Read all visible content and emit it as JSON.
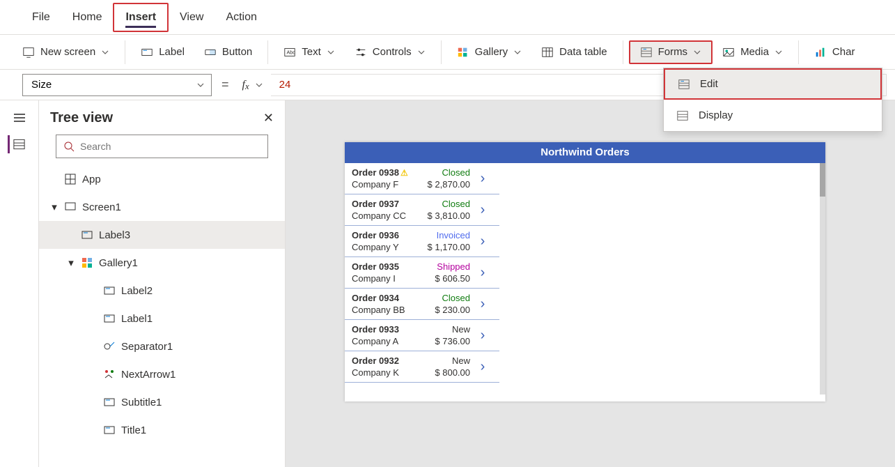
{
  "menubar": [
    "File",
    "Home",
    "Insert",
    "View",
    "Action"
  ],
  "menubar_active": 2,
  "ribbon": {
    "new_screen": "New screen",
    "label_btn": "Label",
    "button": "Button",
    "text": "Text",
    "controls": "Controls",
    "gallery": "Gallery",
    "data_table": "Data table",
    "forms": "Forms",
    "media": "Media",
    "chart": "Char"
  },
  "formula": {
    "property": "Size",
    "value": "24"
  },
  "panel": {
    "title": "Tree view",
    "search_placeholder": "Search",
    "tree": [
      {
        "lvl": 1,
        "icon": "app",
        "label": "App",
        "tw": ""
      },
      {
        "lvl": 1,
        "icon": "screen",
        "label": "Screen1",
        "tw": "▾"
      },
      {
        "lvl": 2,
        "icon": "label",
        "label": "Label3",
        "tw": "",
        "sel": true
      },
      {
        "lvl": 2,
        "icon": "gallery",
        "label": "Gallery1",
        "tw": "▾"
      },
      {
        "lvl": 3,
        "icon": "label",
        "label": "Label2",
        "tw": ""
      },
      {
        "lvl": 3,
        "icon": "label",
        "label": "Label1",
        "tw": ""
      },
      {
        "lvl": 3,
        "icon": "sep",
        "label": "Separator1",
        "tw": ""
      },
      {
        "lvl": 3,
        "icon": "arrow",
        "label": "NextArrow1",
        "tw": ""
      },
      {
        "lvl": 3,
        "icon": "label",
        "label": "Subtitle1",
        "tw": ""
      },
      {
        "lvl": 3,
        "icon": "label",
        "label": "Title1",
        "tw": ""
      }
    ]
  },
  "app": {
    "title": "Northwind Orders",
    "rows": [
      {
        "order": "Order 0938",
        "warn": true,
        "status": "Closed",
        "status_color": "#107c10",
        "company": "Company F",
        "amount": "$ 2,870.00"
      },
      {
        "order": "Order 0937",
        "status": "Closed",
        "status_color": "#107c10",
        "company": "Company CC",
        "amount": "$ 3,810.00"
      },
      {
        "order": "Order 0936",
        "status": "Invoiced",
        "status_color": "#4f6bed",
        "company": "Company Y",
        "amount": "$ 1,170.00"
      },
      {
        "order": "Order 0935",
        "status": "Shipped",
        "status_color": "#b4009e",
        "company": "Company I",
        "amount": "$ 606.50"
      },
      {
        "order": "Order 0934",
        "status": "Closed",
        "status_color": "#107c10",
        "company": "Company BB",
        "amount": "$ 230.00"
      },
      {
        "order": "Order 0933",
        "status": "New",
        "status_color": "#323130",
        "company": "Company A",
        "amount": "$ 736.00"
      },
      {
        "order": "Order 0932",
        "status": "New",
        "status_color": "#323130",
        "company": "Company K",
        "amount": "$ 800.00"
      }
    ]
  },
  "forms_menu": {
    "edit": "Edit",
    "display": "Display"
  }
}
